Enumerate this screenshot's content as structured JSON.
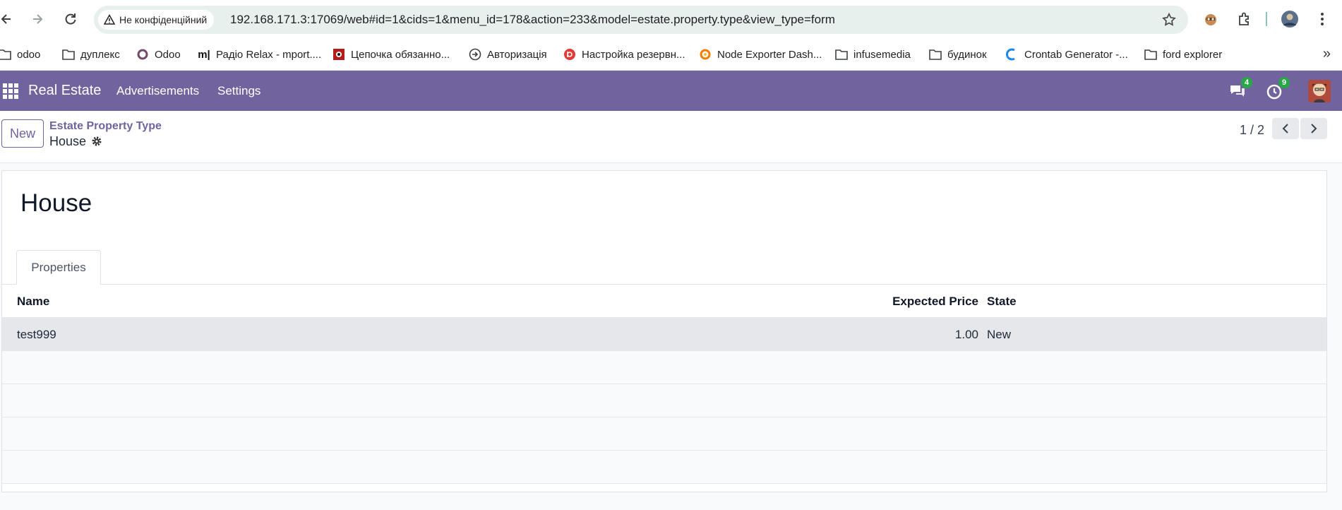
{
  "browser": {
    "security_label": "Не конфіденційний",
    "url": "192.168.171.3:17069/web#id=1&cids=1&menu_id=178&action=233&model=estate.property.type&view_type=form",
    "bookmarks": [
      {
        "label": "odoo",
        "icon": "folder-icon"
      },
      {
        "label": "дуплекс",
        "icon": "folder-icon"
      },
      {
        "label": "Odoo",
        "icon": "odoo-logo-icon"
      },
      {
        "label": "Радіо Relax - mport....",
        "icon": "mport-logo-icon"
      },
      {
        "label": "Цепочка обязанно...",
        "icon": "chain-icon"
      },
      {
        "label": "Авторизація",
        "icon": "login-arrow-icon"
      },
      {
        "label": "Настройка резервн...",
        "icon": "backup-icon"
      },
      {
        "label": "Node Exporter Dash...",
        "icon": "grafana-icon"
      },
      {
        "label": "infusemedia",
        "icon": "folder-icon"
      },
      {
        "label": "будинок",
        "icon": "folder-icon"
      },
      {
        "label": "Crontab Generator -...",
        "icon": "crontab-icon"
      },
      {
        "label": "ford explorer",
        "icon": "folder-icon"
      }
    ]
  },
  "navbar": {
    "brand": "Real Estate",
    "menu": [
      "Advertisements",
      "Settings"
    ],
    "messages_count": "4",
    "activities_count": "9",
    "color": "#71639e"
  },
  "control_panel": {
    "new_label": "New",
    "breadcrumb_parent": "Estate Property Type",
    "breadcrumb_current": "House",
    "pager": "1 / 2"
  },
  "form": {
    "title": "House",
    "tabs": [
      "Properties"
    ],
    "columns": [
      "Name",
      "Expected Price",
      "State"
    ],
    "rows": [
      {
        "name": "test999",
        "expected_price": "1.00",
        "state": "New"
      }
    ]
  }
}
